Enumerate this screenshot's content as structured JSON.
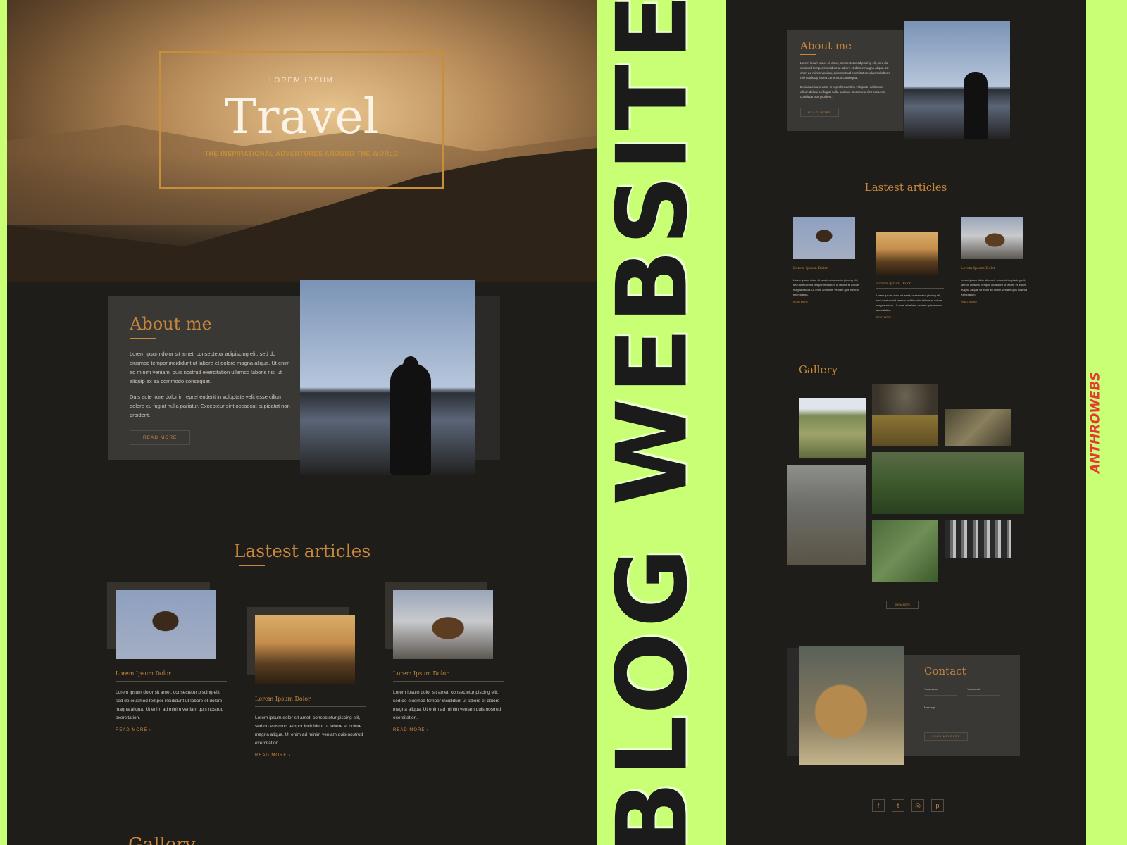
{
  "banner": {
    "text": "BLOG WEBSITE"
  },
  "logo": {
    "text": "ANTHROWEBS"
  },
  "hero": {
    "eyebrow": "LOREM IPSUM",
    "title": "Travel",
    "subtitle": "THE INSPIRATIONAL ADVENTURES AROUND THE WORLD"
  },
  "about": {
    "title": "About me",
    "p1": "Lorem ipsum dolor sit amet, consectetur adipiscing elit, sed do eiusmod tempor incididunt ut labore et dolore magna aliqua. Ut enim ad minim veniam, quis nostrud exercitation ullamco laboris nisi ut aliquip ex ea commodo consequat.",
    "p2": "Duis aute irure dolor in reprehenderit in voluptate velit esse cillum dolore eu fugiat nulla pariatur. Excepteur sint occaecat cupidatat non proident.",
    "button": "READ MORE"
  },
  "articles": {
    "title": "Lastest articles",
    "items": [
      {
        "caption": "Lorem Ipsum Dolor",
        "text": "Lorem ipsum dolor sit amet, consectetur piscing elit, sed do eiusmod tempor incididunt ut labore et dolore magna aliqua. Ut enim ad minim veniam quis nostrud exercitation.",
        "more": "READ MORE  ›"
      },
      {
        "caption": "Lorem Ipsum Dolor",
        "text": "Lorem ipsum dolor sit amet, consectetur piscing elit, sed do eiusmod tempor incididunt ut labore et dolore magna aliqua. Ut enim ad minim veniam quis nostrud exercitation.",
        "more": "READ MORE  ›"
      },
      {
        "caption": "Lorem Ipsum Dolor",
        "text": "Lorem ipsum dolor sit amet, consectetur piscing elit, sed do eiusmod tempor incididunt ut labore et dolore magna aliqua. Ut enim ad minim veniam quis nostrud exercitation.",
        "more": "READ MORE  ›"
      }
    ]
  },
  "gallery": {
    "title": "Gallery",
    "show_more": "SHOW MORE"
  },
  "contact": {
    "title": "Contact",
    "name_label": "Your name",
    "email_label": "Your email",
    "message_label": "Message",
    "button": "SEND MESSAGE"
  },
  "social": [
    "f",
    "t",
    "◎",
    "p"
  ],
  "colors": {
    "accent": "#c8873d",
    "background": "#1f1d1a",
    "card": "#3a3835",
    "banner": "#c9ff75"
  }
}
